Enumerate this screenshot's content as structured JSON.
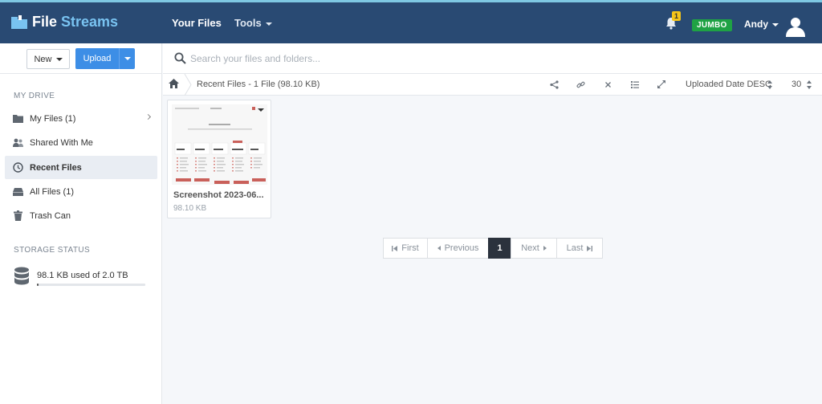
{
  "app": {
    "logo_part1": "File",
    "logo_part2": "Streams"
  },
  "nav": {
    "your_files": "Your Files",
    "tools": "Tools",
    "notification_count": "1",
    "plan_badge": "JUMBO",
    "user_name": "Andy"
  },
  "sidebar": {
    "new_label": "New",
    "upload_label": "Upload",
    "my_drive_title": "MY DRIVE",
    "items": [
      {
        "label": "My Files (1)",
        "icon": "folder-icon"
      },
      {
        "label": "Shared With Me",
        "icon": "users-icon"
      },
      {
        "label": "Recent Files",
        "icon": "clock-icon",
        "active": true
      },
      {
        "label": "All Files (1)",
        "icon": "drive-icon"
      },
      {
        "label": "Trash Can",
        "icon": "trash-icon"
      }
    ],
    "storage_title": "STORAGE STATUS",
    "storage_text": "98.1 KB used of 2.0 TB",
    "storage_used_fraction": 5e-05
  },
  "search": {
    "placeholder": "Search your files and folders..."
  },
  "toolbar": {
    "breadcrumb": "Recent Files - 1 File (98.10 KB)",
    "sort_label": "Uploaded Date DESC",
    "per_page": "30"
  },
  "files": [
    {
      "name": "Screenshot 2023-06...",
      "size": "98.10 KB"
    }
  ],
  "pagination": {
    "first": "First",
    "previous": "Previous",
    "current": "1",
    "next": "Next",
    "last": "Last"
  },
  "colors": {
    "topbar": "#294a73",
    "accent": "#3d8ee6",
    "plan_badge": "#1fa244",
    "logo_accent": "#79c3f1"
  }
}
